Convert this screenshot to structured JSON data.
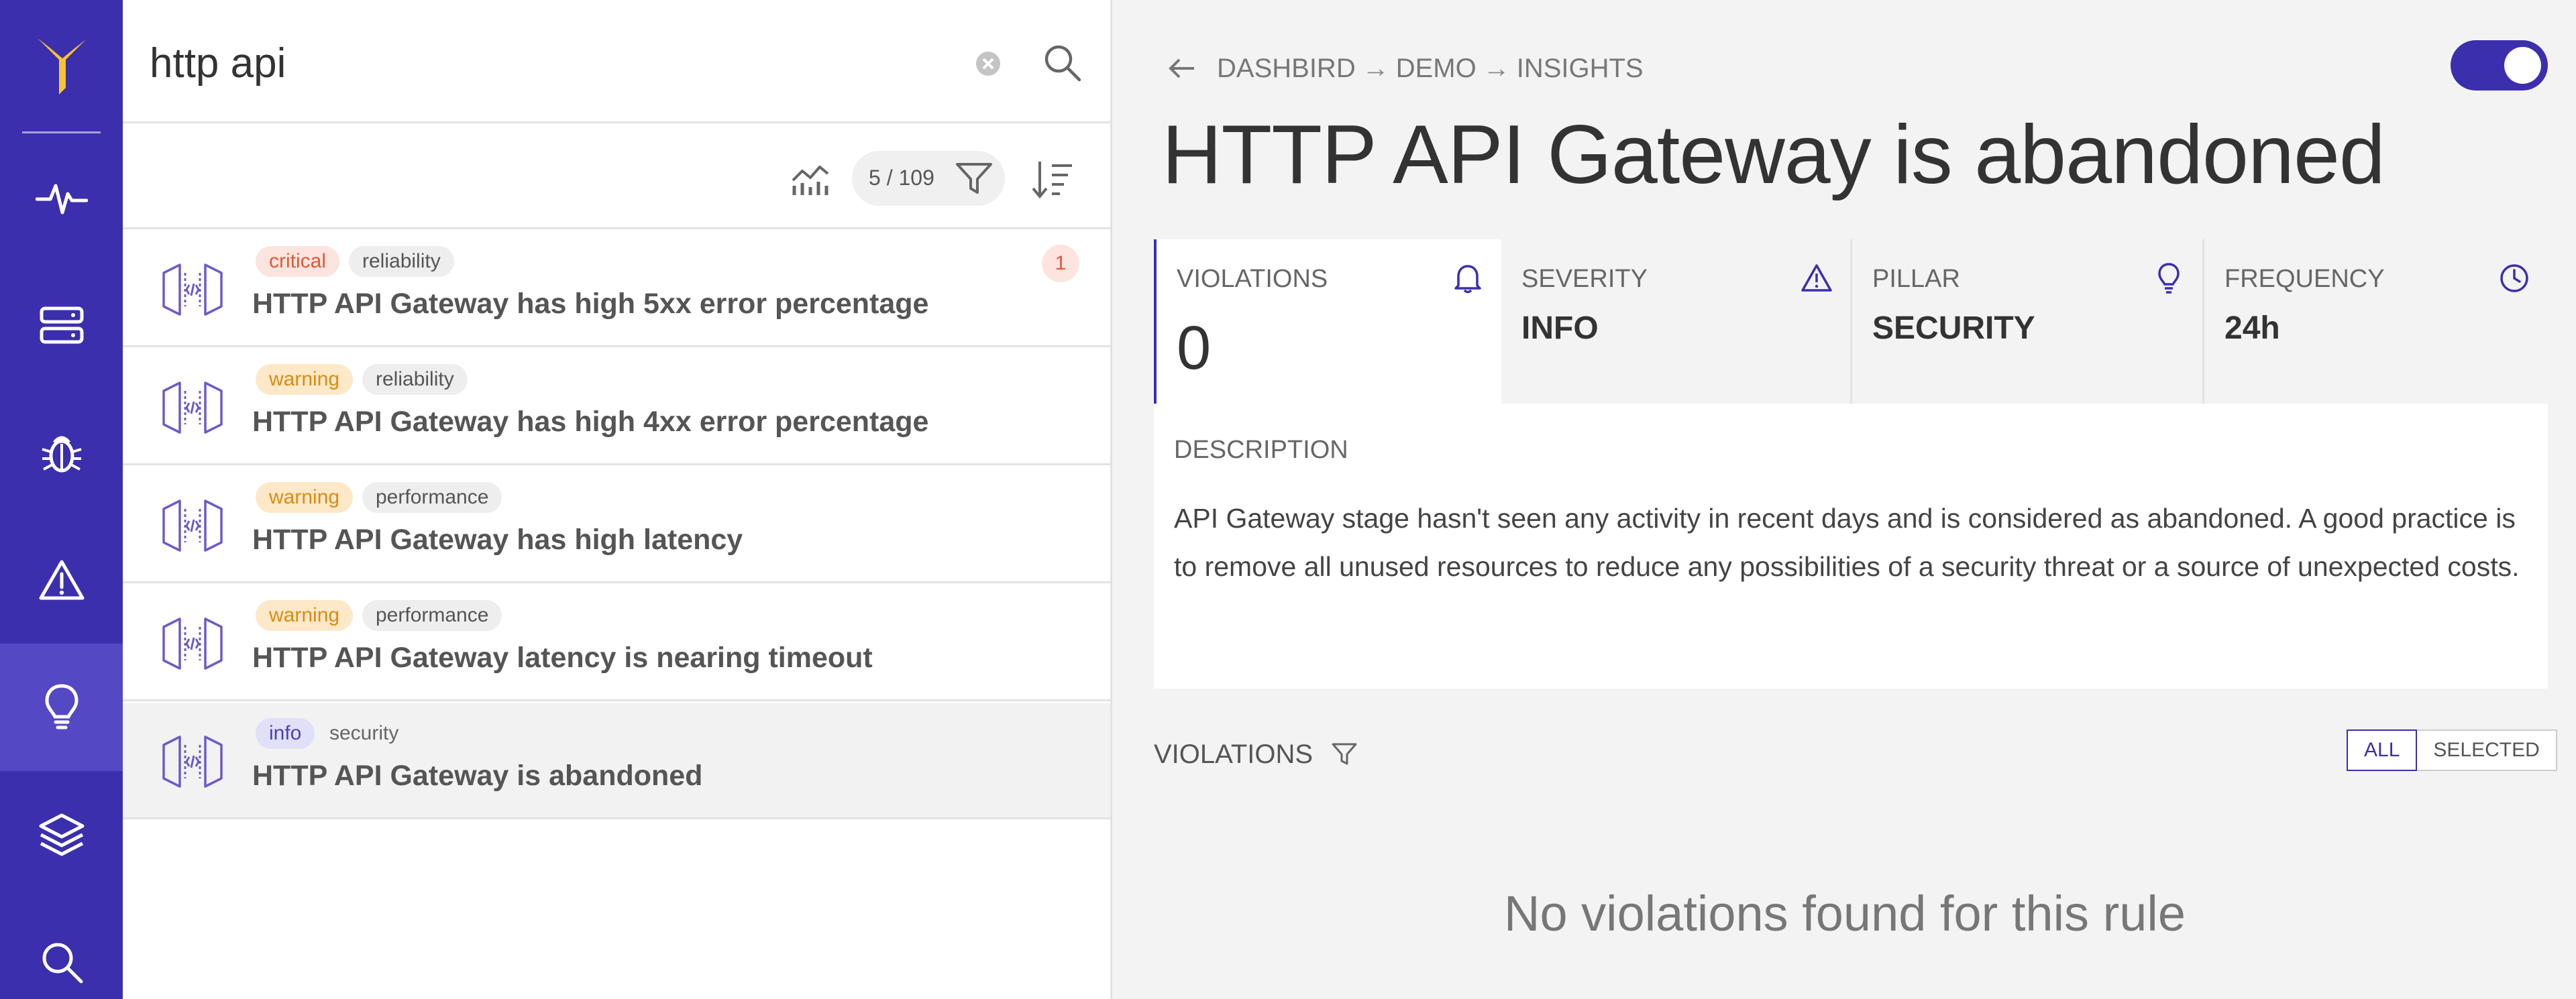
{
  "colors": {
    "rail": "#3b2fae",
    "rail_active": "#5548c4",
    "logo": "#f6c42a",
    "accent": "#3b2fae"
  },
  "nav": [
    {
      "name": "activity-icon"
    },
    {
      "name": "server-icon"
    },
    {
      "name": "bug-icon"
    },
    {
      "name": "alert-triangle-icon"
    },
    {
      "name": "lightbulb-icon",
      "active": true
    },
    {
      "name": "layers-icon"
    },
    {
      "name": "search-icon"
    }
  ],
  "search": {
    "value": "http api",
    "placeholder": ""
  },
  "toolbar": {
    "count": "5 / 109"
  },
  "rules": [
    {
      "severity": "critical",
      "pillar": "reliability",
      "title": "HTTP API Gateway has high 5xx error percentage",
      "count": "1"
    },
    {
      "severity": "warning",
      "pillar": "reliability",
      "title": "HTTP API Gateway has high 4xx error percentage"
    },
    {
      "severity": "warning",
      "pillar": "performance",
      "title": "HTTP API Gateway has high latency"
    },
    {
      "severity": "warning",
      "pillar": "performance",
      "title": "HTTP API Gateway latency is nearing timeout"
    },
    {
      "severity": "info",
      "pillar": "security",
      "title": "HTTP API Gateway is abandoned",
      "selected": true
    }
  ],
  "breadcrumb": [
    "DASHBIRD",
    "DEMO",
    "INSIGHTS"
  ],
  "breadcrumb_arrow": "→",
  "detail": {
    "title": "HTTP API Gateway is abandoned",
    "stats": {
      "violations": {
        "label": "VIOLATIONS",
        "value": "0"
      },
      "severity": {
        "label": "SEVERITY",
        "value": "INFO"
      },
      "pillar": {
        "label": "PILLAR",
        "value": "SECURITY"
      },
      "frequency": {
        "label": "FREQUENCY",
        "value": "24h"
      }
    },
    "description": {
      "label": "DESCRIPTION",
      "text": "API Gateway stage hasn't seen any activity in recent days and is considered as abandoned. A good practice is to remove all unused resources to reduce any possibilities of a security threat or a source of unexpected costs."
    },
    "violations_header": "VIOLATIONS",
    "filter_all": "ALL",
    "filter_selected": "SELECTED",
    "empty_message": "No violations found for this rule"
  },
  "tag_colors": {
    "critical": {
      "bg": "#fde4de",
      "fg": "#e2583a"
    },
    "warning": {
      "bg": "#fde9c8",
      "fg": "#dd8a12"
    },
    "info": {
      "bg": "#e1e0f8",
      "fg": "#4a40b8"
    }
  }
}
